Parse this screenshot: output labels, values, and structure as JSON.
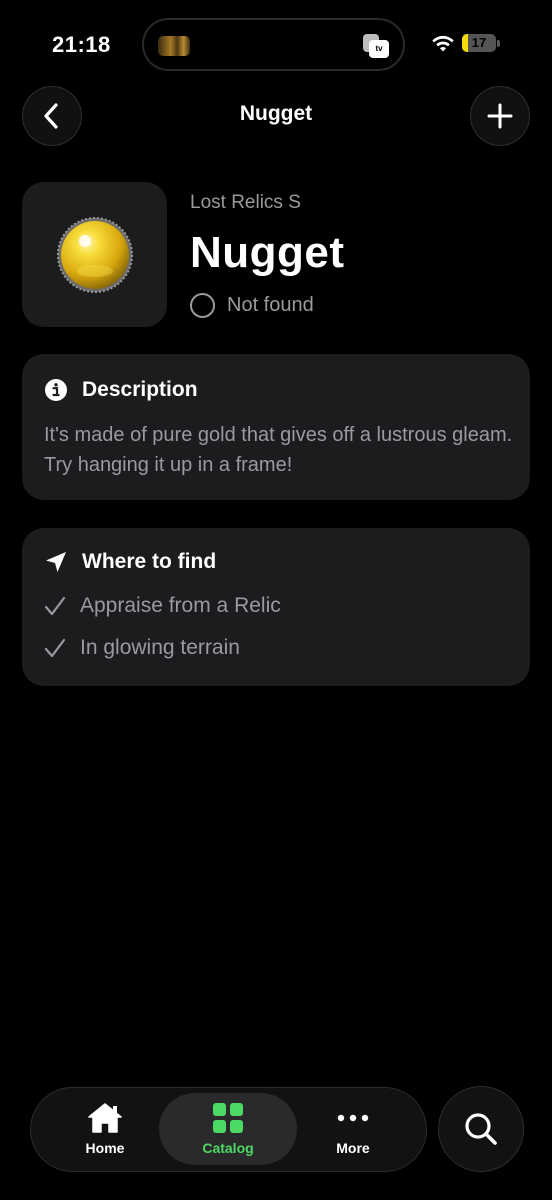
{
  "status_bar": {
    "time": "21:18",
    "battery_level": "17",
    "battery_fraction": 0.17,
    "island_icons": [
      "media-artwork-icon",
      "apple-tv-icon"
    ],
    "island_tv_label": "tv"
  },
  "nav": {
    "title": "Nugget",
    "back_icon": "chevron-left-icon",
    "add_icon": "plus-icon"
  },
  "item": {
    "series": "Lost Relics S",
    "name": "Nugget",
    "status": "Not found",
    "image_icon": "gold-nugget-icon"
  },
  "description": {
    "heading": "Description",
    "icon": "info-icon",
    "text": "It's made of pure gold that gives off a lustrous gleam. Try hanging it up in a frame!"
  },
  "where_to_find": {
    "heading": "Where to find",
    "icon": "location-arrow-icon",
    "items": [
      {
        "label": "Appraise from a Relic"
      },
      {
        "label": "In glowing terrain"
      }
    ]
  },
  "tab_bar": {
    "tabs": [
      {
        "label": "Home",
        "icon": "house-icon",
        "active": false
      },
      {
        "label": "Catalog",
        "icon": "grid-icon",
        "active": true
      },
      {
        "label": "More",
        "icon": "ellipsis-icon",
        "active": false
      }
    ],
    "search_icon": "search-icon"
  },
  "colors": {
    "background": "#000000",
    "card": "#1c1c1e",
    "secondary_text": "#9a9a9f",
    "accent_green": "#4cd964",
    "battery_yellow": "#f5d90a"
  }
}
